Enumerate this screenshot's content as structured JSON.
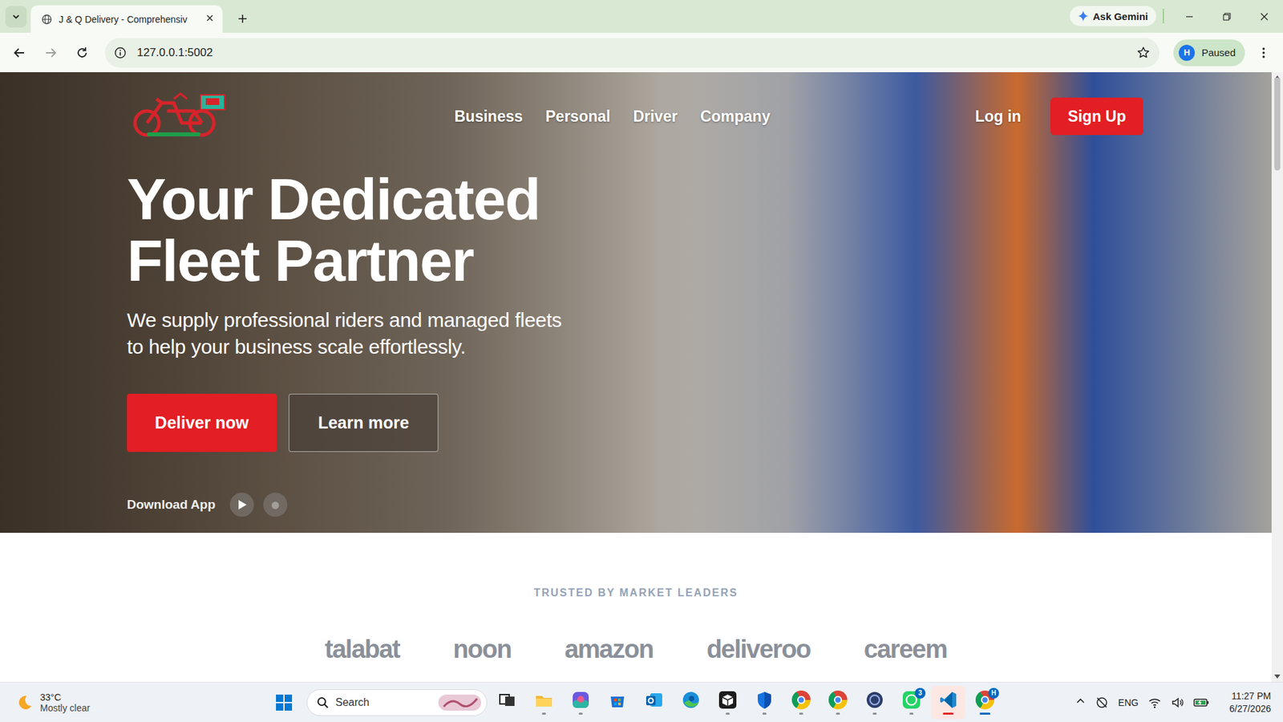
{
  "browser": {
    "tabs": [
      {
        "label": "J & Q Delivery - Comprehensiv",
        "selected": true
      }
    ],
    "ask_gemini": "Ask Gemini",
    "address": "127.0.0.1:5002",
    "profile": {
      "initial": "H",
      "status": "Paused"
    }
  },
  "site": {
    "nav": [
      "Business",
      "Personal",
      "Driver",
      "Company"
    ],
    "login": "Log in",
    "signup": "Sign Up",
    "headline": [
      "Your Dedicated",
      "Fleet Partner"
    ],
    "subtitle": [
      "We supply professional riders and managed fleets",
      "to help your business scale effortlessly."
    ],
    "buttons": [
      {
        "label": "Deliver now",
        "kind": "primary"
      },
      {
        "label": "Learn more",
        "kind": "secondary"
      }
    ],
    "download_label": "Download App",
    "trusted_title": "TRUSTED BY MARKET LEADERS",
    "partners": [
      "talabat",
      "noon",
      "amazon",
      "deliveroo",
      "careem"
    ]
  },
  "taskbar": {
    "weather": {
      "temp": "33°C",
      "condition": "Mostly clear"
    },
    "search": "Search",
    "apps": [
      {
        "kind": "taskview",
        "running": false,
        "active": false,
        "attention": false
      },
      {
        "kind": "explorer",
        "running": true,
        "active": false,
        "attention": false
      },
      {
        "kind": "m365",
        "running": true,
        "active": false,
        "attention": false
      },
      {
        "kind": "store",
        "running": false,
        "active": false,
        "attention": false
      },
      {
        "kind": "outlook",
        "running": false,
        "active": false,
        "attention": false
      },
      {
        "kind": "edge",
        "running": false,
        "active": false,
        "attention": false
      },
      {
        "kind": "cube",
        "running": true,
        "active": false,
        "attention": false
      },
      {
        "kind": "defender",
        "running": true,
        "active": false,
        "attention": false
      },
      {
        "kind": "chrome",
        "running": true,
        "active": false,
        "attention": false
      },
      {
        "kind": "chrome",
        "running": true,
        "active": false,
        "attention": false
      },
      {
        "kind": "ur",
        "running": true,
        "active": false,
        "attention": false
      },
      {
        "kind": "whatsapp",
        "running": true,
        "active": false,
        "attention": false,
        "badge": "3"
      },
      {
        "kind": "vscode",
        "running": true,
        "active": false,
        "attention": true
      },
      {
        "kind": "chrome",
        "running": true,
        "active": true,
        "attention": false,
        "badge": "H"
      }
    ],
    "tray": {
      "language": "ENG",
      "time": "11:27 PM",
      "date": "6/27/2026"
    }
  }
}
